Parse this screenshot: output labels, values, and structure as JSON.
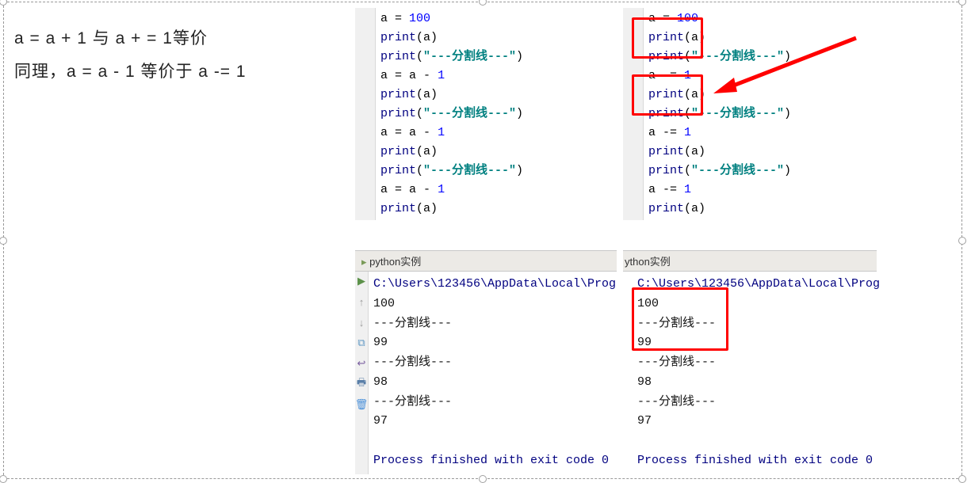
{
  "text": {
    "line1": "a = a + 1 与 a + = 1等价",
    "line2": "同理，a = a - 1 等价于 a -= 1"
  },
  "code_left": [
    [
      [
        "id",
        "a"
      ],
      [
        "op",
        " = "
      ],
      [
        "num",
        "100"
      ]
    ],
    [
      [
        "fn",
        "print"
      ],
      [
        "paren",
        "("
      ],
      [
        "id",
        "a"
      ],
      [
        "paren",
        ")"
      ]
    ],
    [
      [
        "fn",
        "print"
      ],
      [
        "paren",
        "("
      ],
      [
        "str",
        "\"---分割线---\""
      ],
      [
        "paren",
        ")"
      ]
    ],
    [
      [
        "id",
        "a"
      ],
      [
        "op",
        " = "
      ],
      [
        "id",
        "a"
      ],
      [
        "op",
        " - "
      ],
      [
        "num",
        "1"
      ]
    ],
    [
      [
        "fn",
        "print"
      ],
      [
        "paren",
        "("
      ],
      [
        "id",
        "a"
      ],
      [
        "paren",
        ")"
      ]
    ],
    [
      [
        "fn",
        "print"
      ],
      [
        "paren",
        "("
      ],
      [
        "str",
        "\"---分割线---\""
      ],
      [
        "paren",
        ")"
      ]
    ],
    [
      [
        "id",
        "a"
      ],
      [
        "op",
        " = "
      ],
      [
        "id",
        "a"
      ],
      [
        "op",
        " - "
      ],
      [
        "num",
        "1"
      ]
    ],
    [
      [
        "fn",
        "print"
      ],
      [
        "paren",
        "("
      ],
      [
        "id",
        "a"
      ],
      [
        "paren",
        ")"
      ]
    ],
    [
      [
        "fn",
        "print"
      ],
      [
        "paren",
        "("
      ],
      [
        "str",
        "\"---分割线---\""
      ],
      [
        "paren",
        ")"
      ]
    ],
    [
      [
        "id",
        "a"
      ],
      [
        "op",
        " = "
      ],
      [
        "id",
        "a"
      ],
      [
        "op",
        " - "
      ],
      [
        "num",
        "1"
      ]
    ],
    [
      [
        "fn",
        "print"
      ],
      [
        "paren",
        "("
      ],
      [
        "id",
        "a"
      ],
      [
        "paren",
        ")"
      ]
    ]
  ],
  "code_right": [
    [
      [
        "id",
        "a"
      ],
      [
        "op",
        " = "
      ],
      [
        "num",
        "100"
      ]
    ],
    [
      [
        "fn",
        "print"
      ],
      [
        "paren",
        "("
      ],
      [
        "id",
        "a"
      ],
      [
        "paren",
        ")"
      ]
    ],
    [
      [
        "fn",
        "print"
      ],
      [
        "paren",
        "("
      ],
      [
        "str",
        "\"---分割线---\""
      ],
      [
        "paren",
        ")"
      ]
    ],
    [
      [
        "id",
        "a"
      ],
      [
        "op",
        " -= "
      ],
      [
        "num",
        "1"
      ]
    ],
    [
      [
        "fn",
        "print"
      ],
      [
        "paren",
        "("
      ],
      [
        "id",
        "a"
      ],
      [
        "paren",
        ")"
      ]
    ],
    [
      [
        "fn",
        "print"
      ],
      [
        "paren",
        "("
      ],
      [
        "str",
        "\"---分割线---\""
      ],
      [
        "paren",
        ")"
      ]
    ],
    [
      [
        "id",
        "a"
      ],
      [
        "op",
        " -= "
      ],
      [
        "num",
        "1"
      ]
    ],
    [
      [
        "fn",
        "print"
      ],
      [
        "paren",
        "("
      ],
      [
        "id",
        "a"
      ],
      [
        "paren",
        ")"
      ]
    ],
    [
      [
        "fn",
        "print"
      ],
      [
        "paren",
        "("
      ],
      [
        "str",
        "\"---分割线---\""
      ],
      [
        "paren",
        ")"
      ]
    ],
    [
      [
        "id",
        "a"
      ],
      [
        "op",
        " -= "
      ],
      [
        "num",
        "1"
      ]
    ],
    [
      [
        "fn",
        "print"
      ],
      [
        "paren",
        "("
      ],
      [
        "id",
        "a"
      ],
      [
        "paren",
        ")"
      ]
    ]
  ],
  "console_left": {
    "tab_marker": "▸",
    "tab": "python实例",
    "path": "C:\\Users\\123456\\AppData\\Local\\Prog",
    "lines": [
      "100",
      "---分割线---",
      "99",
      "---分割线---",
      "98",
      "---分割线---",
      "97"
    ],
    "exit": "Process finished with exit code 0"
  },
  "console_right": {
    "tab": "ython实例",
    "path": "C:\\Users\\123456\\AppData\\Local\\Prog",
    "lines": [
      "100",
      "---分割线---",
      "99",
      "---分割线---",
      "98",
      "---分割线---",
      "97"
    ],
    "exit": "Process finished with exit code 0"
  },
  "icons": {
    "play": "▶",
    "up": "↑",
    "down": "↓",
    "box": "⧉",
    "wrap": "↩",
    "print": "🖶",
    "trash": "🗑"
  }
}
